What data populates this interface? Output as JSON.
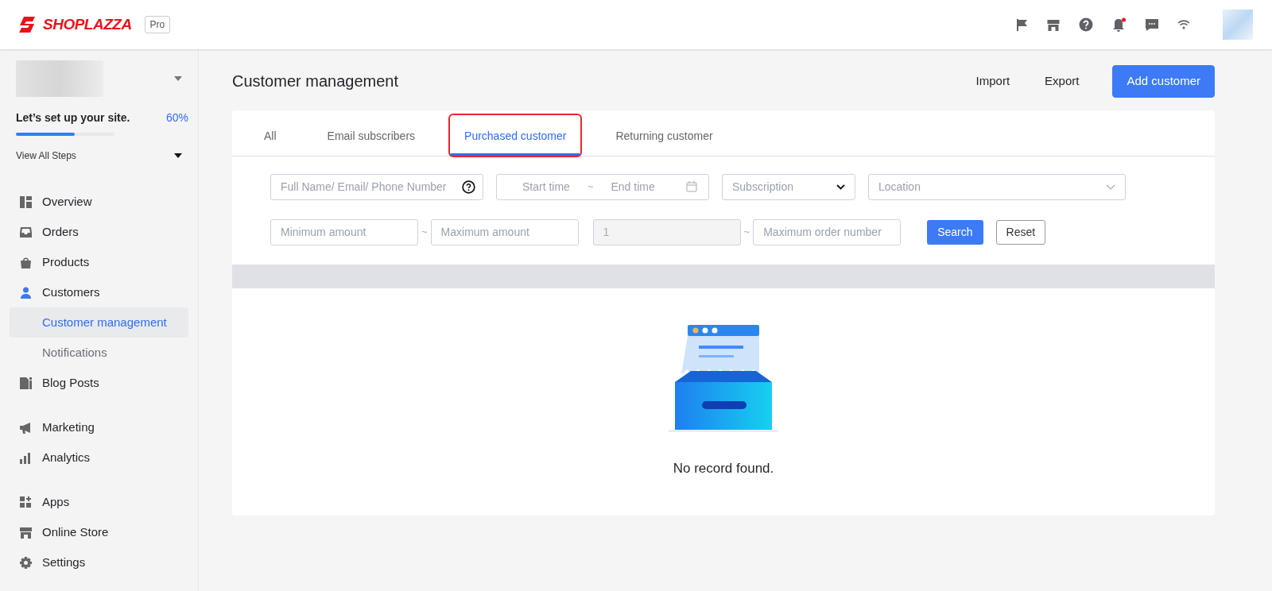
{
  "header": {
    "logo": "SHOPLAZZA",
    "plan_badge": "Pro",
    "notification_unread": true
  },
  "sidebar": {
    "setup": {
      "title": "Let’s set up your site.",
      "percent": "60%",
      "level": 0.6,
      "steps_link": "View All Steps"
    },
    "groups": [
      [
        {
          "label": "Overview",
          "selected": false
        },
        {
          "label": "Orders",
          "selected": false
        },
        {
          "label": "Products",
          "selected": false
        },
        {
          "label": "Customers",
          "selected": true,
          "children": [
            {
              "label": "Customer management",
              "selected": true
            },
            {
              "label": "Notifications",
              "selected": false
            }
          ]
        },
        {
          "label": "Blog Posts",
          "selected": false
        }
      ],
      [
        {
          "label": "Marketing",
          "selected": false
        },
        {
          "label": "Analytics",
          "selected": false
        }
      ],
      [
        {
          "label": "Apps",
          "selected": false
        },
        {
          "label": "Online Store",
          "selected": false
        },
        {
          "label": "Settings",
          "selected": false
        }
      ]
    ]
  },
  "page": {
    "title": "Customer management",
    "actions": [
      {
        "label": "Import",
        "kind": "link"
      },
      {
        "label": "Export",
        "kind": "link"
      },
      {
        "label": "Add customer",
        "kind": "primary"
      }
    ]
  },
  "tabs": [
    {
      "label": "All",
      "selected": false,
      "highlighted": false
    },
    {
      "label": "Email subscribers",
      "selected": false,
      "highlighted": false
    },
    {
      "label": "Purchased customer",
      "selected": true,
      "highlighted": true
    },
    {
      "label": "Returning customer",
      "selected": false,
      "highlighted": false
    }
  ],
  "filters": {
    "search": {
      "placeholder": "Full Name/ Email/ Phone Number"
    },
    "date_range": {
      "start_placeholder": "Start time",
      "separator": "~",
      "end_placeholder": "End time"
    },
    "subscription": {
      "placeholder": "Subscription"
    },
    "location": {
      "placeholder": "Location"
    },
    "min_amount": {
      "placeholder": "Minimum amount"
    },
    "amount_separator": "~",
    "max_amount": {
      "placeholder": "Maximum amount"
    },
    "min_orders": {
      "value": "1",
      "disabled": true
    },
    "orders_separator": "~",
    "max_orders": {
      "placeholder": "Maximum order number"
    },
    "search_button": "Search",
    "reset_button": "Reset"
  },
  "empty_state": {
    "message": "No record found."
  }
}
